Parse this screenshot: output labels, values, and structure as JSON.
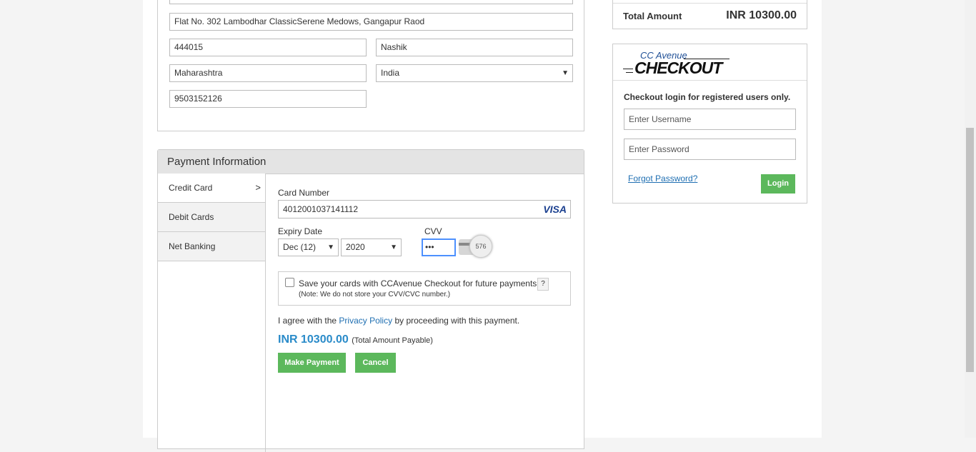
{
  "address": {
    "street": "Flat No. 302 Lambodhar ClassicSerene Medows, Gangapur Raod",
    "pincode": "444015",
    "city": "Nashik",
    "state": "Maharashtra",
    "country": "India",
    "phone": "9503152126"
  },
  "payment": {
    "header": "Payment Information",
    "tabs": [
      {
        "label": "Credit Card",
        "chevron": ">"
      },
      {
        "label": "Debit Cards"
      },
      {
        "label": "Net Banking"
      }
    ],
    "card_number_label": "Card Number",
    "card_number": "4012001037141112",
    "card_brand": "VISA",
    "expiry_label": "Expiry Date",
    "expiry_month": "Dec (12)",
    "expiry_year": "2020",
    "cvv_label": "CVV",
    "cvv_value": "•••",
    "cvv_hint": "576",
    "save_cards_label": "Save your cards with CCAvenue Checkout for future payments",
    "help_label": "?",
    "save_note": "(Note: We do not store your CVV/CVC number.)",
    "agree_prefix": "I agree with the",
    "privacy_link": "Privacy Policy",
    "agree_suffix": "by proceeding with this payment.",
    "amount": "INR 10300.00",
    "amount_note": "(Total Amount Payable)",
    "make_payment": "Make Payment",
    "cancel": "Cancel"
  },
  "summary": {
    "total_label": "Total Amount",
    "total_value": "INR 10300.00"
  },
  "checkout": {
    "logo_top": "CC Avenue",
    "logo_bottom": "CHECKOUT",
    "heading": "Checkout login for registered users only.",
    "username_placeholder": "Enter Username",
    "password_placeholder": "Enter Password",
    "forgot": "Forgot Password?",
    "login": "Login"
  },
  "colors": {
    "accent_green": "#5cb85c",
    "amount_blue": "#2a8bc9",
    "link_blue": "#1f6fb2",
    "visa_blue": "#1a3f8f"
  }
}
